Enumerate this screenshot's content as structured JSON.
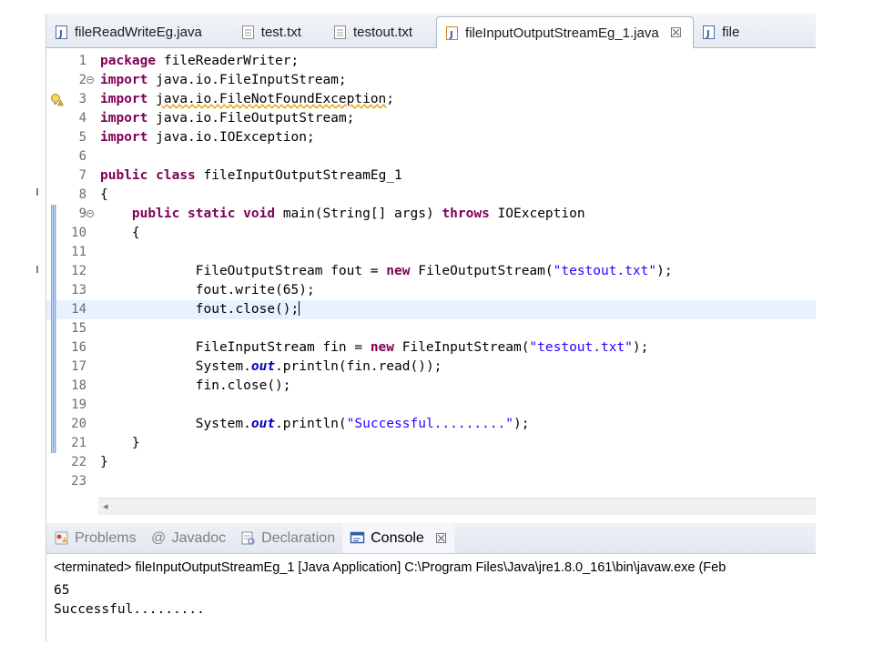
{
  "editor_tabs": [
    {
      "label": "fileReadWriteEg.java",
      "icon": "java-file-icon",
      "active": false
    },
    {
      "label": "test.txt",
      "icon": "text-file-icon",
      "active": false
    },
    {
      "label": "testout.txt",
      "icon": "text-file-icon",
      "active": false
    },
    {
      "label": "fileInputOutputStreamEg_1.java",
      "icon": "java-file-icon",
      "active": true,
      "close": "☒"
    },
    {
      "label": "file",
      "icon": "java-file-icon",
      "active": false
    }
  ],
  "editor": {
    "lines": [
      {
        "num": "1",
        "tokens": [
          {
            "t": "package",
            "c": "kw"
          },
          {
            "t": " fileReaderWriter;"
          }
        ]
      },
      {
        "num": "2",
        "fold": true,
        "tokens": [
          {
            "t": "import",
            "c": "kw"
          },
          {
            "t": " java.io.FileInputStream;"
          }
        ]
      },
      {
        "num": "3",
        "warning": true,
        "tokens": [
          {
            "t": "import",
            "c": "kw"
          },
          {
            "t": " "
          },
          {
            "t": "java.io.FileNotFoundException",
            "c": "squig"
          },
          {
            "t": ";"
          }
        ]
      },
      {
        "num": "4",
        "tokens": [
          {
            "t": "import",
            "c": "kw"
          },
          {
            "t": " java.io.FileOutputStream;"
          }
        ]
      },
      {
        "num": "5",
        "tokens": [
          {
            "t": "import",
            "c": "kw"
          },
          {
            "t": " java.io.IOException;"
          }
        ]
      },
      {
        "num": "6",
        "tokens": []
      },
      {
        "num": "7",
        "tokens": [
          {
            "t": "public",
            "c": "kw"
          },
          {
            "t": " "
          },
          {
            "t": "class",
            "c": "kw"
          },
          {
            "t": " fileInputOutputStreamEg_1"
          }
        ]
      },
      {
        "num": "8",
        "tokens": [
          {
            "t": "{"
          }
        ]
      },
      {
        "num": "9",
        "fold": true,
        "changed": true,
        "tokens": [
          {
            "t": "    "
          },
          {
            "t": "public",
            "c": "kw"
          },
          {
            "t": " "
          },
          {
            "t": "static",
            "c": "kw"
          },
          {
            "t": " "
          },
          {
            "t": "void",
            "c": "kw"
          },
          {
            "t": " main(String[] args) "
          },
          {
            "t": "throws",
            "c": "kw"
          },
          {
            "t": " IOException"
          }
        ]
      },
      {
        "num": "10",
        "changed": true,
        "tokens": [
          {
            "t": "    {"
          }
        ]
      },
      {
        "num": "11",
        "changed": true,
        "tokens": []
      },
      {
        "num": "12",
        "changed": true,
        "tokens": [
          {
            "t": "            FileOutputStream fout = "
          },
          {
            "t": "new",
            "c": "kw"
          },
          {
            "t": " FileOutputStream("
          },
          {
            "t": "\"testout.txt\"",
            "c": "str"
          },
          {
            "t": ");"
          }
        ]
      },
      {
        "num": "13",
        "changed": true,
        "tokens": [
          {
            "t": "            fout.write(65);"
          }
        ]
      },
      {
        "num": "14",
        "changed": true,
        "current": true,
        "caret": true,
        "tokens": [
          {
            "t": "            fout.close();"
          }
        ]
      },
      {
        "num": "15",
        "changed": true,
        "tokens": []
      },
      {
        "num": "16",
        "changed": true,
        "tokens": [
          {
            "t": "            FileInputStream fin = "
          },
          {
            "t": "new",
            "c": "kw"
          },
          {
            "t": " FileInputStream("
          },
          {
            "t": "\"testout.txt\"",
            "c": "str"
          },
          {
            "t": ");"
          }
        ]
      },
      {
        "num": "17",
        "changed": true,
        "tokens": [
          {
            "t": "            System."
          },
          {
            "t": "out",
            "c": "fld"
          },
          {
            "t": ".println(fin.read());"
          }
        ]
      },
      {
        "num": "18",
        "changed": true,
        "tokens": [
          {
            "t": "            fin.close();"
          }
        ]
      },
      {
        "num": "19",
        "changed": true,
        "tokens": []
      },
      {
        "num": "20",
        "changed": true,
        "tokens": [
          {
            "t": "            System."
          },
          {
            "t": "out",
            "c": "fld"
          },
          {
            "t": ".println("
          },
          {
            "t": "\"Successful.........\"",
            "c": "str"
          },
          {
            "t": ");"
          }
        ]
      },
      {
        "num": "21",
        "changed": true,
        "tokens": [
          {
            "t": "    }"
          }
        ]
      },
      {
        "num": "22",
        "tokens": [
          {
            "t": "}"
          }
        ]
      },
      {
        "num": "23",
        "tokens": []
      }
    ]
  },
  "scroll": {
    "left_arrow": "◂"
  },
  "console_panel": {
    "tabs": [
      {
        "label": "Problems",
        "icon": "problems-icon",
        "active": false
      },
      {
        "label": "Javadoc",
        "icon": "javadoc-at-icon",
        "glyph": "@",
        "active": false
      },
      {
        "label": "Declaration",
        "icon": "declaration-icon",
        "active": false
      },
      {
        "label": "Console",
        "icon": "console-icon",
        "active": true,
        "close": "☒"
      }
    ],
    "status": "<terminated> fileInputOutputStreamEg_1 [Java Application] C:\\Program Files\\Java\\jre1.8.0_161\\bin\\javaw.exe (Feb",
    "output": [
      "65",
      "Successful........."
    ]
  },
  "colors": {
    "keyword": "#7f0055",
    "string": "#2a00ff",
    "field": "#0000c0",
    "current_line": "#e8f2fe"
  }
}
